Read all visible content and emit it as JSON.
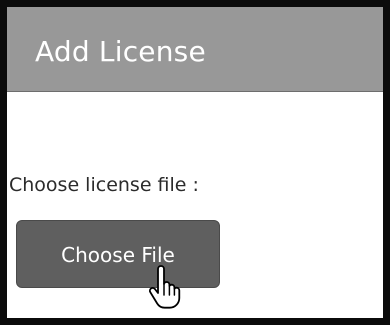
{
  "dialog": {
    "title": "Add License",
    "field_label": "Choose license file :",
    "choose_button_label": "Choose File"
  },
  "colors": {
    "header_bg": "#989898",
    "button_bg": "#5f5f5f",
    "frame_border": "#0b0b0b"
  },
  "icons": {
    "cursor": "hand-pointer-icon"
  }
}
